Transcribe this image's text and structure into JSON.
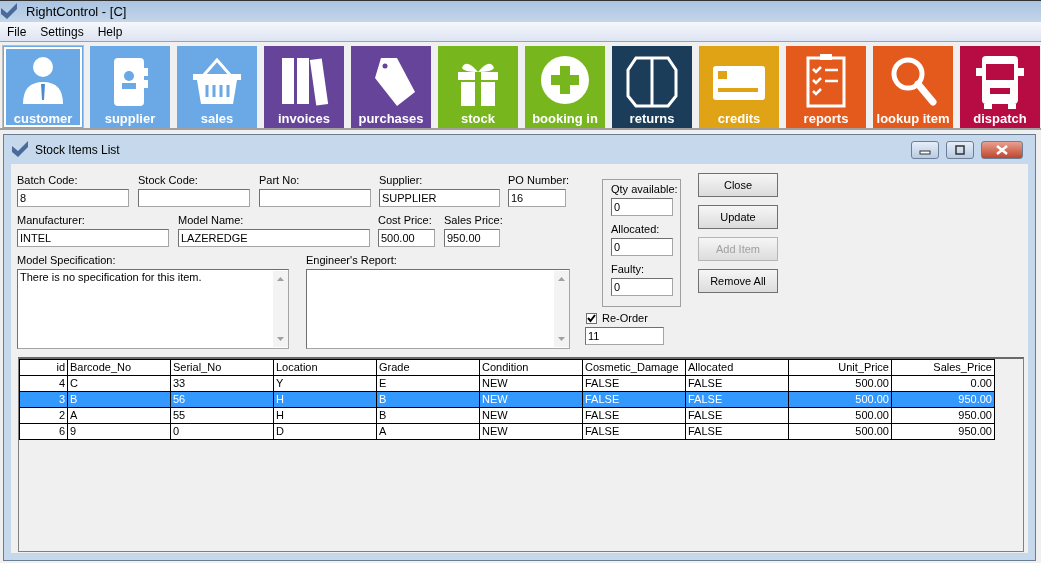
{
  "window": {
    "title": "RightControl - [C]"
  },
  "menu": [
    "File",
    "Settings",
    "Help"
  ],
  "toolbar": [
    {
      "label": "customer",
      "kind": "person",
      "color": "#6aa8e6",
      "selected": true
    },
    {
      "label": "supplier",
      "kind": "contacts",
      "color": "#6aa8e6",
      "selected": false
    },
    {
      "label": "sales",
      "kind": "basket",
      "color": "#6aa8e6",
      "selected": false
    },
    {
      "label": "invoices",
      "kind": "books",
      "color": "#65449a",
      "selected": false
    },
    {
      "label": "purchases",
      "kind": "tag",
      "color": "#65449a",
      "selected": false
    },
    {
      "label": "stock",
      "kind": "gift",
      "color": "#78b61e",
      "selected": false
    },
    {
      "label": "booking in",
      "kind": "plus",
      "color": "#78b61e",
      "selected": false
    },
    {
      "label": "returns",
      "kind": "box",
      "color": "#1c3d5a",
      "selected": false
    },
    {
      "label": "credits",
      "kind": "card",
      "color": "#e0a315",
      "selected": false
    },
    {
      "label": "reports",
      "kind": "clipboard",
      "color": "#e35a1c",
      "selected": false
    },
    {
      "label": "lookup item",
      "kind": "search",
      "color": "#e35a1c",
      "selected": false
    },
    {
      "label": "dispatch",
      "kind": "truck",
      "color": "#b70b43",
      "selected": false
    }
  ],
  "child_window": {
    "title": "Stock Items List",
    "fields": [
      {
        "label": "Batch Code:",
        "value": "8"
      },
      {
        "label": "Stock Code:"
      },
      {
        "label": "Part No:"
      },
      {
        "label": "Supplier:",
        "value": "SUPPLIER"
      },
      {
        "label": "PO Number:",
        "value": "16"
      },
      {
        "label": "Manufacturer:",
        "value": "INTEL"
      },
      {
        "label": "Model Name:",
        "value": "LAZEREDGE"
      },
      {
        "label": "Cost Price:",
        "value": "500.00"
      },
      {
        "label": "Sales Price:",
        "value": "950.00"
      }
    ],
    "model_specification": {
      "label": "Model Specification:",
      "value": "There is no specification for this item."
    },
    "engineers_report": {
      "label": "Engineer's Report:"
    },
    "quantities": [
      {
        "label": "Qty available:",
        "value": "0"
      },
      {
        "label": "Allocated:",
        "value": "0"
      },
      {
        "label": "Faulty:",
        "value": "0"
      }
    ],
    "reorder": {
      "label": "Re-Order",
      "checked": true,
      "value": "11"
    },
    "buttons": [
      {
        "label": "Close",
        "disabled": false
      },
      {
        "label": "Update",
        "disabled": false
      },
      {
        "label": "Add Item",
        "disabled": true
      },
      {
        "label": "Remove All",
        "disabled": false
      }
    ],
    "table": {
      "columns": [
        {
          "label": "id",
          "right_aligned": true
        },
        {
          "label": "Barcode_No",
          "right_aligned": false
        },
        {
          "label": "Serial_No",
          "right_aligned": false
        },
        {
          "label": "Location",
          "right_aligned": false
        },
        {
          "label": "Grade",
          "right_aligned": false
        },
        {
          "label": "Condition",
          "right_aligned": false
        },
        {
          "label": "Cosmetic_Damage",
          "right_aligned": false
        },
        {
          "label": "Allocated",
          "right_aligned": false
        },
        {
          "label": "Unit_Price",
          "right_aligned": true
        },
        {
          "label": "Sales_Price",
          "right_aligned": true
        }
      ],
      "rows": [
        {
          "cells": [
            "4",
            "C",
            "33",
            "Y",
            "E",
            "NEW",
            "FALSE",
            "FALSE",
            "500.00",
            "0.00"
          ],
          "selected": false
        },
        {
          "cells": [
            "3",
            "B",
            "56",
            "H",
            "B",
            "NEW",
            "FALSE",
            "FALSE",
            "500.00",
            "950.00"
          ],
          "selected": true
        },
        {
          "cells": [
            "2",
            "A",
            "55",
            "H",
            "B",
            "NEW",
            "FALSE",
            "FALSE",
            "500.00",
            "950.00"
          ],
          "selected": false
        },
        {
          "cells": [
            "6",
            "9",
            "0",
            "D",
            "A",
            "NEW",
            "FALSE",
            "FALSE",
            "500.00",
            "950.00"
          ],
          "selected": false
        }
      ]
    }
  }
}
